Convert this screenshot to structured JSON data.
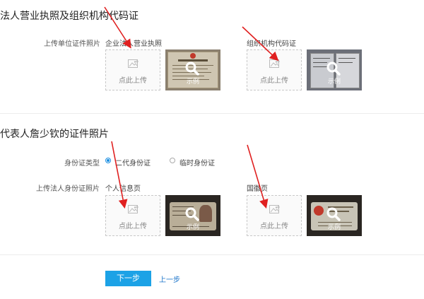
{
  "section1": {
    "title": "法人营业执照及组织机构代码证",
    "upload_label": "上传单位证件照片",
    "business_license_label": "企业法人营业执照",
    "org_code_label": "组织机构代码证",
    "upload_text": "点此上传",
    "sample_text": "示例"
  },
  "section2": {
    "title": "代表人詹少钦的证件照片",
    "id_type_label": "身份证类型",
    "id_type_options": [
      "二代身份证",
      "临时身份证"
    ],
    "id_type_selected": "二代身份证",
    "upload_label": "上传法人身份证照片",
    "personal_page_label": "个人信息页",
    "national_emblem_label": "国徽页",
    "upload_text": "点此上传",
    "sample_text": "示例"
  },
  "footer": {
    "next_label": "下一步",
    "prev_label": "上一步"
  },
  "colors": {
    "primary": "#1ca2e6",
    "link": "#1a73c9",
    "arrow": "#e02020"
  }
}
